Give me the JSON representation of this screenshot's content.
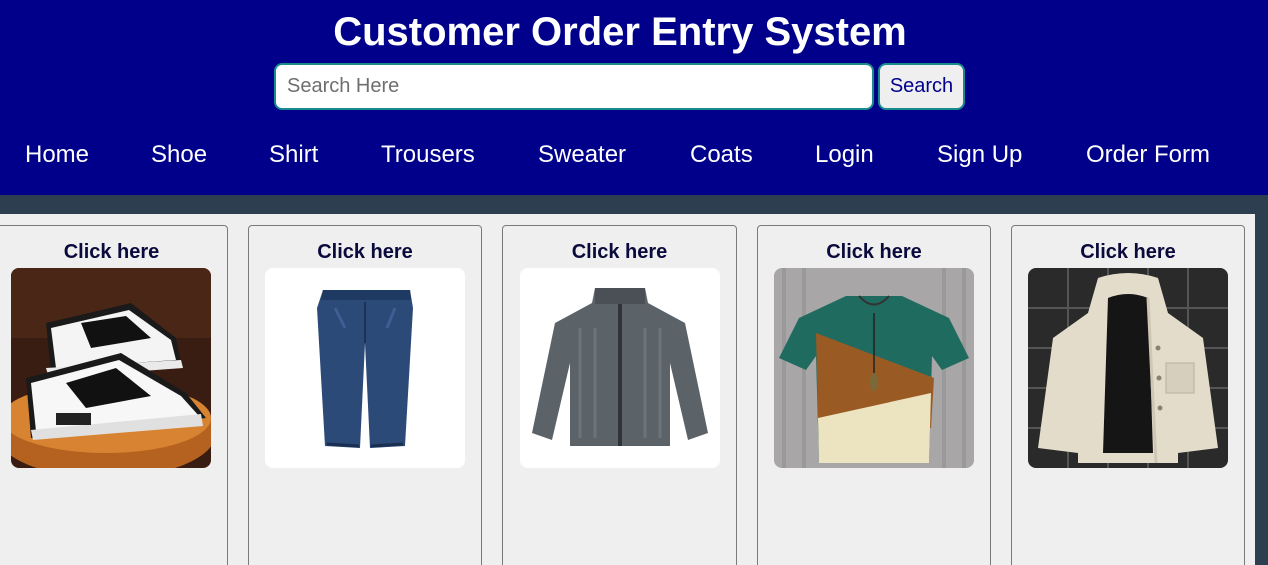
{
  "header": {
    "title": "Customer Order Entry System",
    "search_placeholder": "Search Here",
    "search_button": "Search"
  },
  "nav": [
    "Home",
    "Shoe",
    "Shirt",
    "Trousers",
    "Sweater",
    "Coats",
    "Login",
    "Sign Up",
    "Order Form"
  ],
  "products": [
    {
      "link": "Click here",
      "image": "sneaker-image"
    },
    {
      "link": "Click here",
      "image": "jeans-image"
    },
    {
      "link": "Click here",
      "image": "cardigan-image"
    },
    {
      "link": "Click here",
      "image": "tshirt-image"
    },
    {
      "link": "Click here",
      "image": "jacket-image"
    }
  ],
  "colors": {
    "header_bg": "#00008b",
    "page_bg": "#2c3e50",
    "content_bg": "#efefef",
    "accent_border": "#1a8b8b"
  }
}
